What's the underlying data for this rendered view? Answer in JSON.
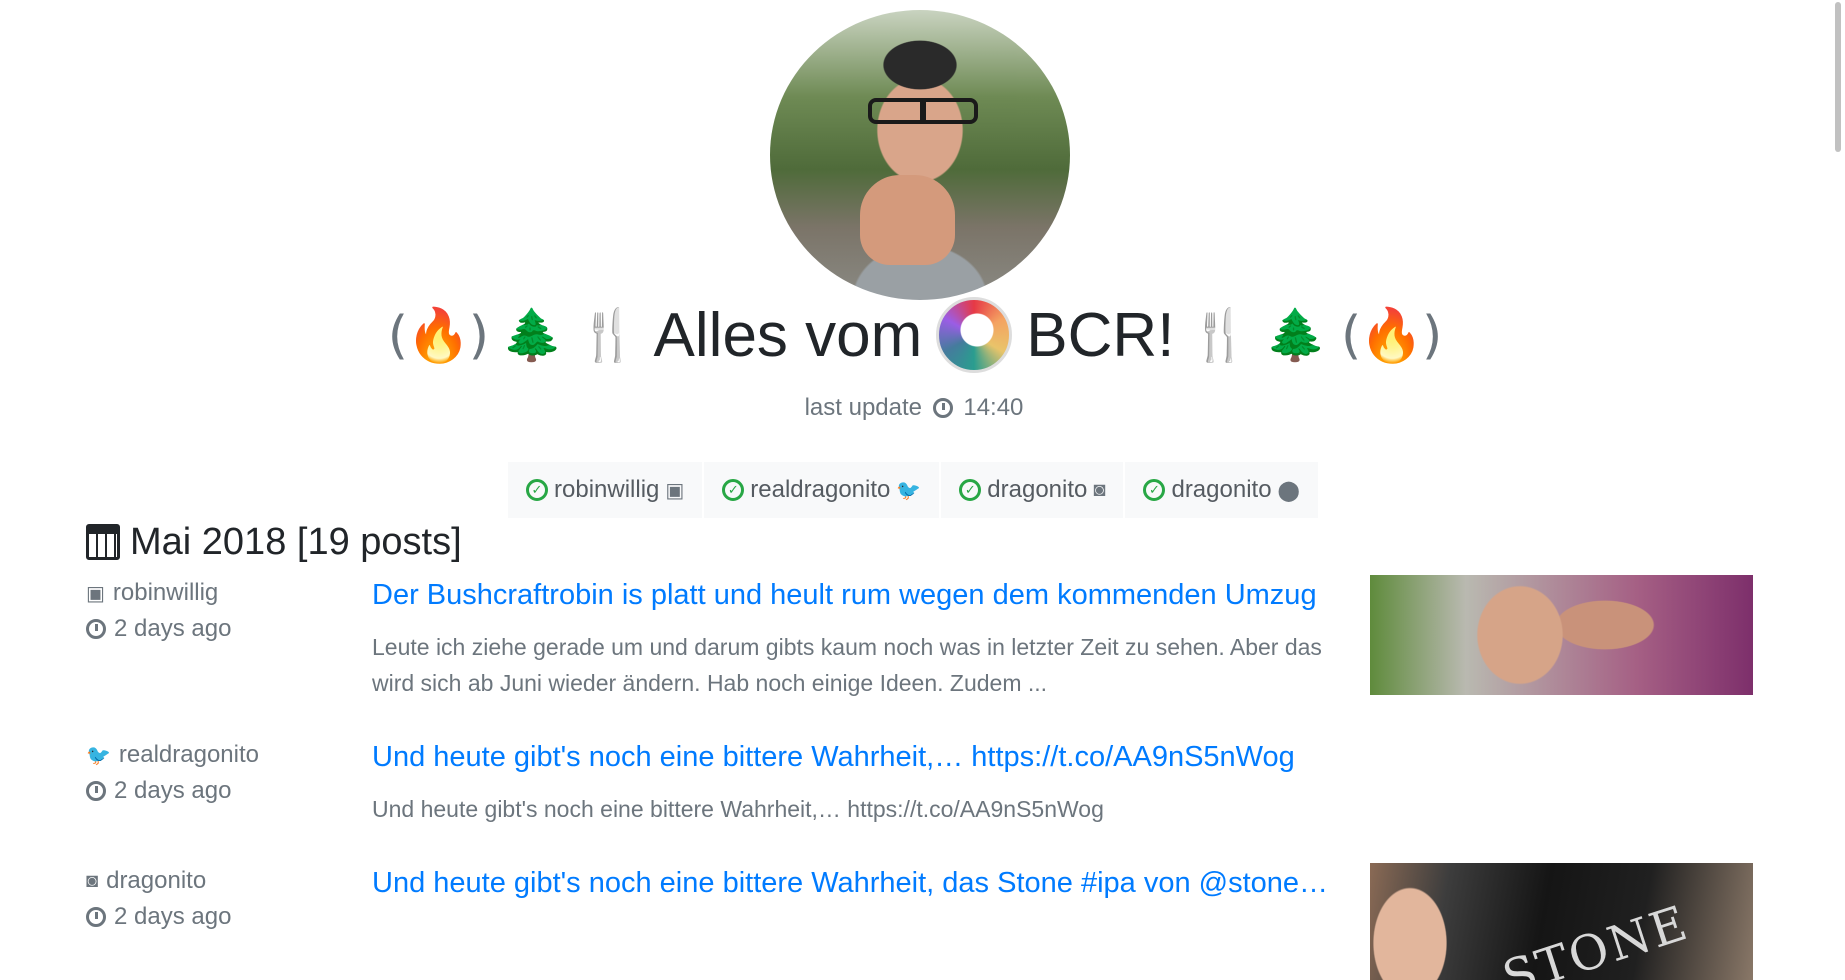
{
  "header": {
    "title_text": "Alles vom",
    "title_suffix": "BCR!",
    "left_icons": [
      "freecodecamp-icon",
      "tree-icon",
      "cutlery-icon"
    ],
    "right_icons": [
      "cutlery-icon",
      "tree-icon",
      "freecodecamp-icon"
    ],
    "last_update_label": "last update",
    "last_update_time": "14:40"
  },
  "accounts": [
    {
      "name": "robinwillig",
      "service_icon": "youtube-icon"
    },
    {
      "name": "realdragonito",
      "service_icon": "twitter-icon"
    },
    {
      "name": "dragonito",
      "service_icon": "instagram-icon"
    },
    {
      "name": "dragonito",
      "service_icon": "flickr-icon"
    }
  ],
  "month": {
    "label": "Mai 2018 [19 posts]"
  },
  "posts": [
    {
      "service_icon": "youtube-icon",
      "author": "robinwillig",
      "time": "2 days ago",
      "title": "Der Bushcraftrobin is platt und heult rum wegen dem kommenden Umzug",
      "text": "Leute ich ziehe gerade um und darum gibts kaum noch was in letzter Zeit zu sehen. Aber das wird sich ab Juni wieder ändern. Hab noch einige Ideen. Zudem ..."
    },
    {
      "service_icon": "twitter-icon",
      "author": "realdragonito",
      "time": "2 days ago",
      "title": "Und heute gibt's noch eine bittere Wahrheit,… https://t.co/AA9nS5nWog",
      "text": "Und heute gibt's noch eine bittere Wahrheit,… https://t.co/AA9nS5nWog"
    },
    {
      "service_icon": "instagram-icon",
      "author": "dragonito",
      "time": "2 days ago",
      "title": "Und heute gibt's noch eine bittere Wahrheit, das Stone #ipa von @stonebrewing",
      "thumb_text": "STONE"
    }
  ]
}
